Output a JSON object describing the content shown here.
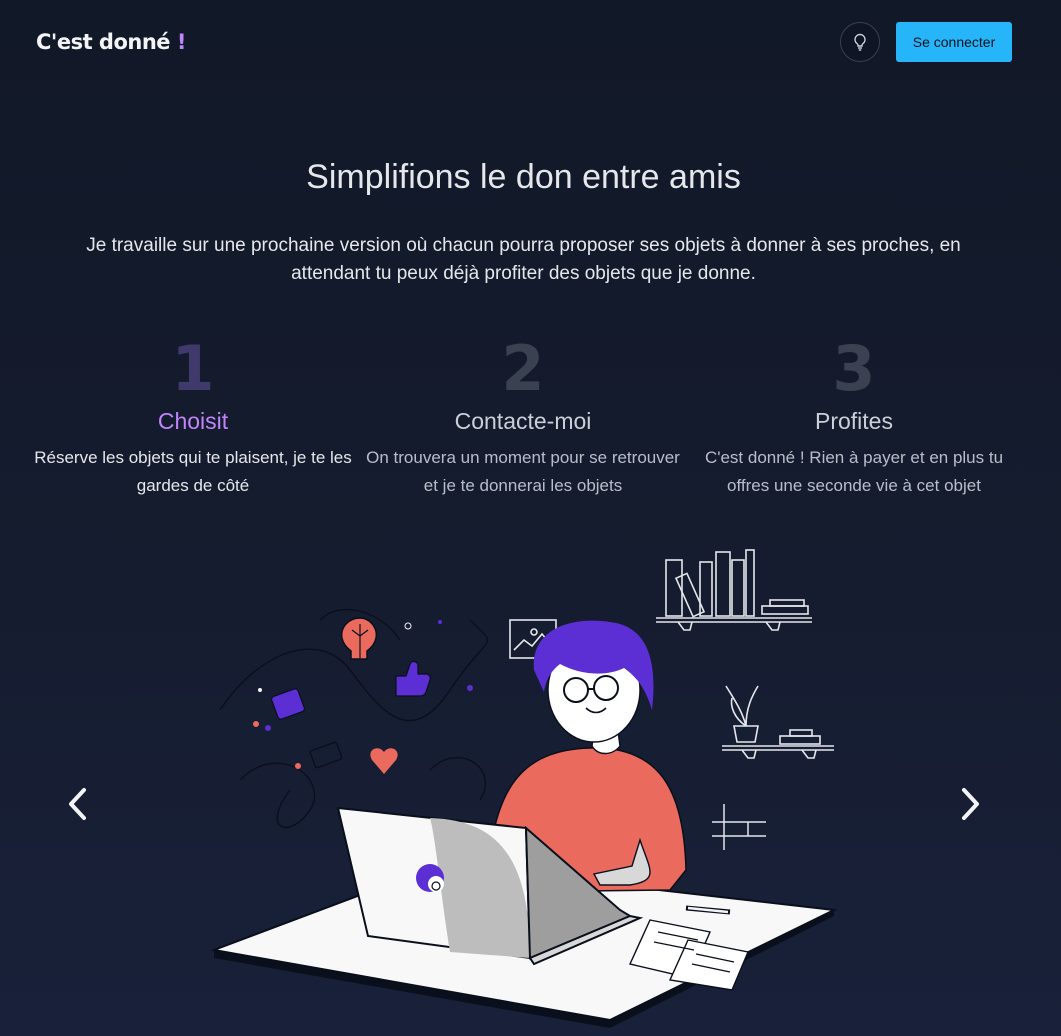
{
  "header": {
    "logo_text": "C'est donné",
    "logo_accent": "!",
    "login_label": "Se connecter",
    "theme_icon": "lightbulb-icon"
  },
  "hero": {
    "title": "Simplifions le don entre amis",
    "description": "Je travaille sur une prochaine version où chacun pourra proposer ses objets à donner à ses proches, en attendant tu peux déjà profiter des objets que je donne."
  },
  "steps": [
    {
      "number": "1",
      "title": "Choisit",
      "description": "Réserve les objets qui te plaisent, je te les gardes de côté"
    },
    {
      "number": "2",
      "title": "Contacte-moi",
      "description": "On trouvera un moment pour se retrouver et je te donnerai les objets"
    },
    {
      "number": "3",
      "title": "Profites",
      "description": "C'est donné ! Rien à payer et en plus tu offres une seconde vie à cet objet"
    }
  ],
  "carousel": {
    "prev_icon": "chevron-left-icon",
    "next_icon": "chevron-right-icon"
  },
  "colors": {
    "background": "#131a2c",
    "accent_purple": "#c084fc",
    "login_blue": "#26b5f8",
    "shirt": "#ea6a5e",
    "hair": "#5b2fd4"
  }
}
